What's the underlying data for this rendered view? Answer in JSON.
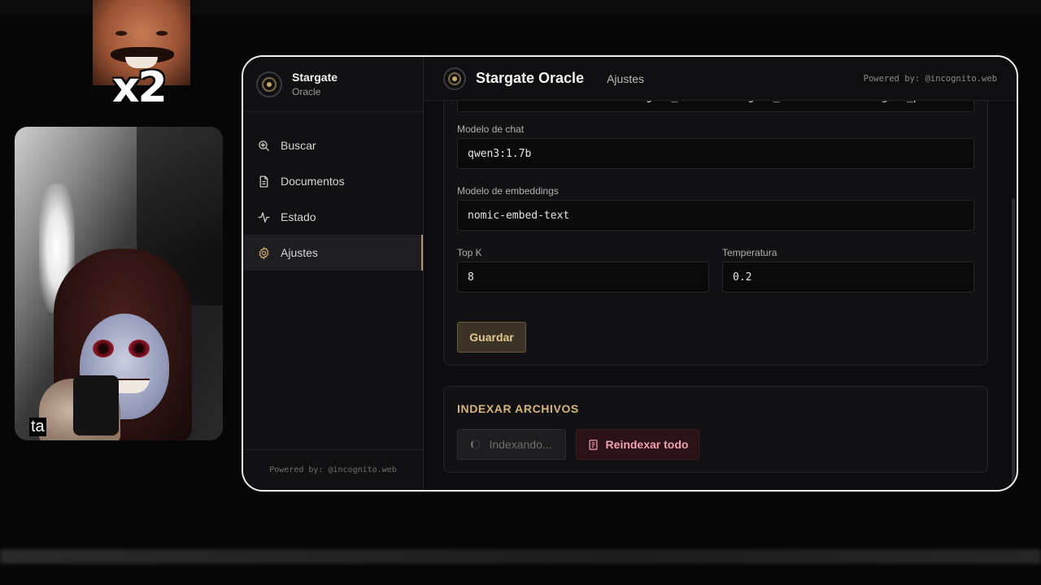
{
  "overlay": {
    "meme_text": "x2",
    "webcam_caption": "ta"
  },
  "brand": {
    "title": "Stargate",
    "subtitle": "Oracle"
  },
  "sidebar": {
    "items": [
      {
        "label": "Buscar",
        "icon": "search-plus-icon",
        "active": false
      },
      {
        "label": "Documentos",
        "icon": "document-icon",
        "active": false
      },
      {
        "label": "Estado",
        "icon": "activity-icon",
        "active": false
      },
      {
        "label": "Ajustes",
        "icon": "gear-icon",
        "active": true
      }
    ],
    "footer": "Powered by: @incognito.web"
  },
  "topbar": {
    "title": "Stargate Oracle",
    "section": "Ajustes",
    "powered": "Powered by: @incognito.web"
  },
  "settings": {
    "docs_path": "C:\\Users\\USER\\Documents\\Stargate_Oracle\\stargate_oracle\\data\\stargate_pdfs",
    "chat_model_label": "Modelo de chat",
    "chat_model_value": "qwen3:1.7b",
    "embed_model_label": "Modelo de embeddings",
    "embed_model_value": "nomic-embed-text",
    "topk_label": "Top K",
    "topk_value": "8",
    "temperature_label": "Temperatura",
    "temperature_value": "0.2",
    "save_label": "Guardar"
  },
  "indexing": {
    "heading": "INDEXAR ARCHIVOS",
    "indexing_label": "Indexando...",
    "reindex_label": "Reindexar todo"
  },
  "colors": {
    "accent": "#c9a86a",
    "danger_text": "#f0a2b0",
    "background": "#0d0d0f"
  }
}
